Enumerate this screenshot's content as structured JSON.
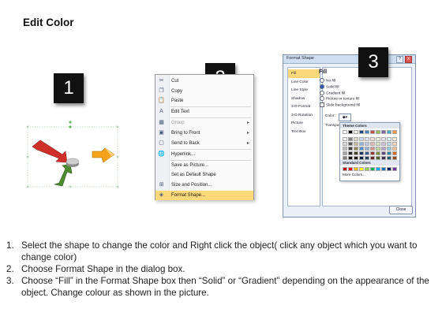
{
  "title": "Edit Color",
  "badges": {
    "one": "1",
    "two": "2",
    "three": "3"
  },
  "context_menu": {
    "items": [
      {
        "icon": "cut-icon",
        "glyph": "✂",
        "label": "Cut",
        "disabled": false,
        "submenu": false
      },
      {
        "icon": "copy-icon",
        "glyph": "❐",
        "label": "Copy",
        "disabled": false,
        "submenu": false
      },
      {
        "icon": "paste-icon",
        "glyph": "📋",
        "label": "Paste",
        "disabled": false,
        "submenu": false
      },
      {
        "icon": "edit-text-icon",
        "glyph": "A",
        "label": "Edit Text",
        "disabled": false,
        "submenu": false
      },
      {
        "icon": "group-icon",
        "glyph": "▦",
        "label": "Group",
        "disabled": true,
        "submenu": true
      },
      {
        "icon": "bring-to-front-icon",
        "glyph": "▣",
        "label": "Bring to Front",
        "disabled": false,
        "submenu": true
      },
      {
        "icon": "send-to-back-icon",
        "glyph": "▢",
        "label": "Send to Back",
        "disabled": false,
        "submenu": true
      },
      {
        "icon": "hyperlink-icon",
        "glyph": "🌐",
        "label": "Hyperlink...",
        "disabled": false,
        "submenu": false
      },
      {
        "icon": "save-picture-icon",
        "glyph": "",
        "label": "Save as Picture...",
        "disabled": false,
        "submenu": false
      },
      {
        "icon": "default-shape-icon",
        "glyph": "",
        "label": "Set as Default Shape",
        "disabled": false,
        "submenu": false
      },
      {
        "icon": "size-position-icon",
        "glyph": "⊞",
        "label": "Size and Position...",
        "disabled": false,
        "submenu": false
      },
      {
        "icon": "format-shape-icon",
        "glyph": "◈",
        "label": "Format Shape...",
        "disabled": false,
        "submenu": false
      }
    ]
  },
  "dialog": {
    "title": "Format Shape",
    "help": "?",
    "close_x": "X",
    "sidebar": [
      "Fill",
      "Line Color",
      "Line Style",
      "Shadow",
      "3-D Format",
      "3-D Rotation",
      "Picture",
      "Text Box"
    ],
    "fill_heading": "Fill",
    "options": [
      "No fill",
      "Solid fill",
      "Gradient fill",
      "Picture or texture fill",
      "Slide background fill"
    ],
    "color_label": "Color:",
    "transparency_label": "Transpa",
    "theme_colors": "Theme Colors",
    "standard_colors": "Standard Colors",
    "more_colors": "More Colors...",
    "close_button": "Close",
    "theme_palette": [
      [
        "#ffffff",
        "#000000",
        "#eeece1",
        "#1f497d",
        "#4f81bd",
        "#c0504d",
        "#9bbb59",
        "#8064a2",
        "#4bacc6",
        "#f79646"
      ],
      [
        "#f2f2f2",
        "#7f7f7f",
        "#ddd9c3",
        "#c6d9f0",
        "#dbe5f1",
        "#f2dcdb",
        "#ebf1dd",
        "#e5e0ec",
        "#dbeef3",
        "#fdeada"
      ],
      [
        "#d8d8d8",
        "#595959",
        "#c4bd97",
        "#8db3e2",
        "#b8cce4",
        "#e5b9b7",
        "#d7e3bc",
        "#ccc1d9",
        "#b7dde8",
        "#fbd5b5"
      ],
      [
        "#bfbfbf",
        "#3f3f3f",
        "#938953",
        "#548dd4",
        "#95b3d7",
        "#d99694",
        "#c3d69b",
        "#b2a2c7",
        "#92cddc",
        "#fac08f"
      ],
      [
        "#a5a5a5",
        "#262626",
        "#494429",
        "#17365d",
        "#366092",
        "#953734",
        "#76923c",
        "#5f497a",
        "#31859b",
        "#e36c09"
      ],
      [
        "#7f7f7f",
        "#0c0c0c",
        "#1d1b10",
        "#0f243e",
        "#244061",
        "#632423",
        "#4f6128",
        "#3f3151",
        "#205867",
        "#974806"
      ]
    ],
    "standard_palette": [
      "#c00000",
      "#ff0000",
      "#ffc000",
      "#ffff00",
      "#92d050",
      "#00b050",
      "#00b0f0",
      "#0070c0",
      "#002060",
      "#7030a0"
    ]
  },
  "steps": [
    {
      "num": "1.",
      "text": "Select the shape to change the color and Right click the object( click any object which you want to change color)"
    },
    {
      "num": "2.",
      "text": "Choose Format Shape in the dialog box."
    },
    {
      "num": "3.",
      "text": "Choose “Fill” in the Format Shape box then “Solid” or “Gradient” depending on the appearance of the object. Change colour as shown in the picture."
    }
  ]
}
